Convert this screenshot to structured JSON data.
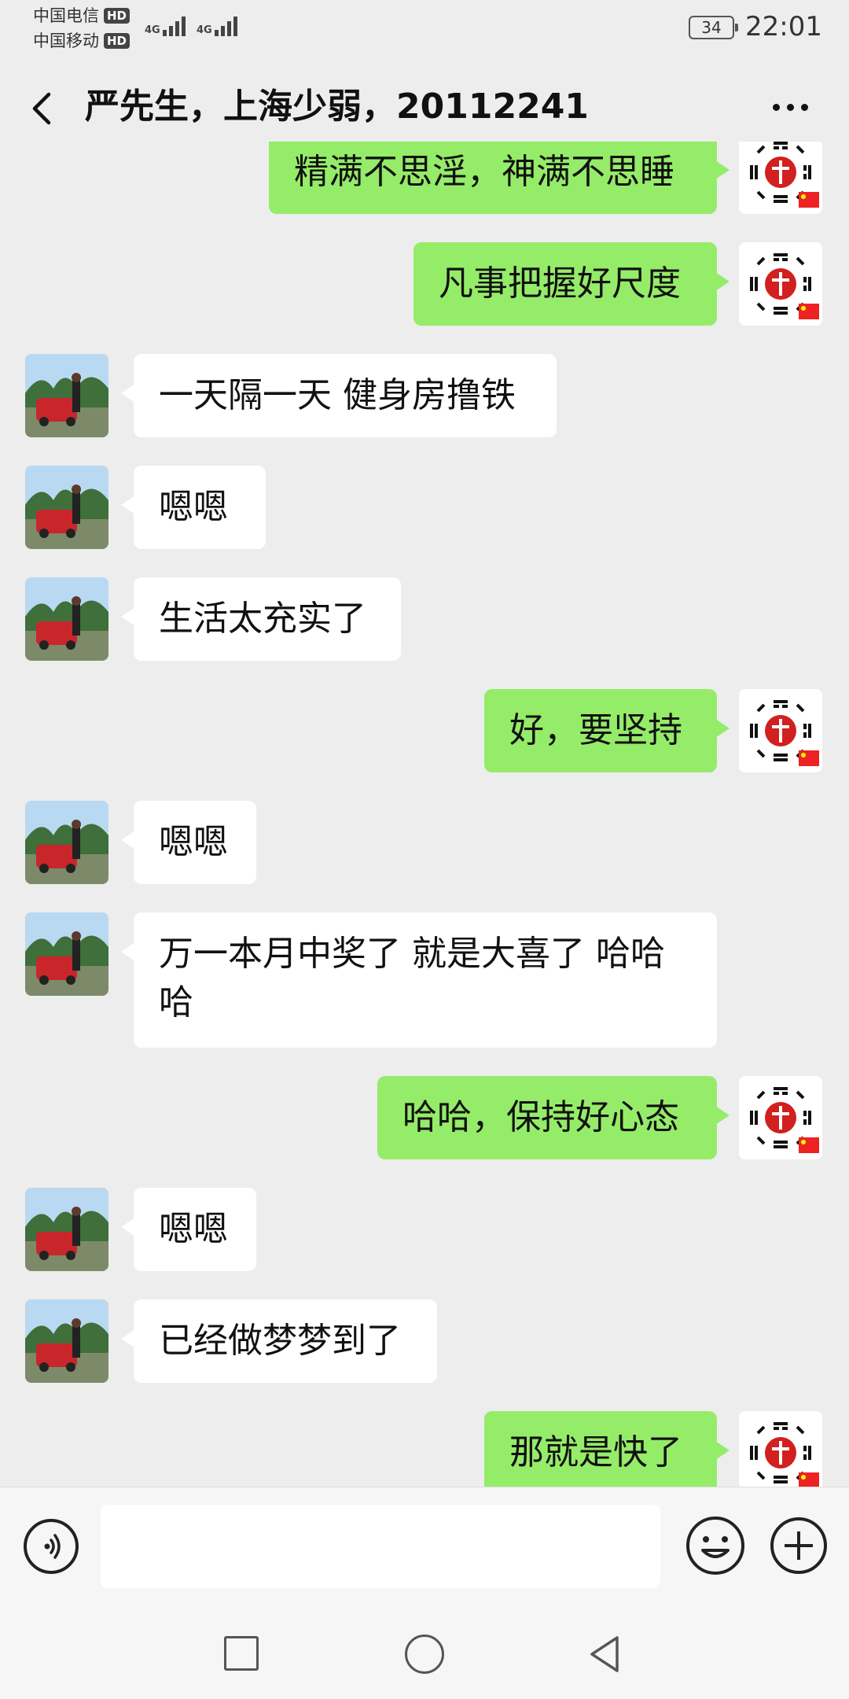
{
  "status_bar": {
    "carrier1": "中国电信",
    "carrier2": "中国移动",
    "hd_label": "HD",
    "network_type": "4G",
    "battery": "34",
    "time": "22:01"
  },
  "header": {
    "title": "严先生，上海少弱，20112241",
    "back_icon": "chevron-left-icon",
    "more_icon": "more-horizontal-icon"
  },
  "messages": [
    {
      "sender": "me",
      "text": "精满不思淫，神满不思睡"
    },
    {
      "sender": "me",
      "text": "凡事把握好尺度"
    },
    {
      "sender": "peer",
      "text": "一天隔一天 健身房撸铁"
    },
    {
      "sender": "peer",
      "text": "嗯嗯"
    },
    {
      "sender": "peer",
      "text": "生活太充实了"
    },
    {
      "sender": "me",
      "text": "好，要坚持"
    },
    {
      "sender": "peer",
      "text": "嗯嗯"
    },
    {
      "sender": "peer",
      "text": "万一本月中奖了 就是大喜了 哈哈哈"
    },
    {
      "sender": "me",
      "text": "哈哈，保持好心态"
    },
    {
      "sender": "peer",
      "text": "嗯嗯"
    },
    {
      "sender": "peer",
      "text": "已经做梦梦到了"
    },
    {
      "sender": "me",
      "text": "那就是快了"
    }
  ],
  "input_bar": {
    "placeholder": "",
    "voice_icon": "voice-icon",
    "emoji_icon": "emoji-icon",
    "plus_icon": "plus-icon"
  },
  "colors": {
    "sent_bubble": "#95ec69",
    "received_bubble": "#ffffff",
    "background": "#ededed"
  }
}
